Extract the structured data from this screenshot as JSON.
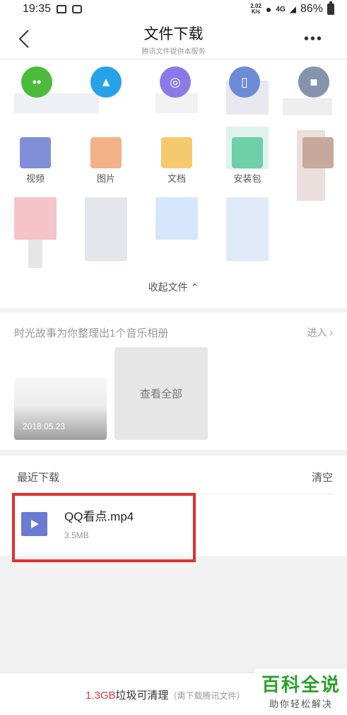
{
  "status_bar": {
    "time": "19:35",
    "speed_value": "2.02",
    "speed_unit": "K/s",
    "network": "4G",
    "battery": "86%"
  },
  "header": {
    "title": "文件下载",
    "subtitle": "腾讯文件提供本服务",
    "more": "•••"
  },
  "file_categories": [
    {
      "label": "",
      "icon": "wechat-icon",
      "color": "#4cbb3b",
      "glyph": "••"
    },
    {
      "label": "",
      "icon": "qq-icon",
      "color": "#26a3e8",
      "glyph": "▲"
    },
    {
      "label": "",
      "icon": "video-icon",
      "color": "#8a7ae8",
      "glyph": "◎"
    },
    {
      "label": "",
      "icon": "phone-icon",
      "color": "#6c8cd8",
      "glyph": "▯"
    },
    {
      "label": "",
      "icon": "lock-icon",
      "color": "#8494ac",
      "glyph": "■"
    },
    {
      "label": "视频",
      "icon": "video-category-icon",
      "color": "#7f8fd8",
      "glyph": ""
    },
    {
      "label": "图片",
      "icon": "image-category-icon",
      "color": "#f3b188",
      "glyph": ""
    },
    {
      "label": "文档",
      "icon": "document-category-icon",
      "color": "#f7c96e",
      "glyph": ""
    },
    {
      "label": "安装包",
      "icon": "package-category-icon",
      "color": "#6fd0a8",
      "glyph": ""
    },
    {
      "label": "",
      "icon": "other-category-icon",
      "color": "#c7a89c",
      "glyph": ""
    }
  ],
  "collapse_label": "收起文件",
  "album": {
    "title": "时光故事为你整理出1个音乐相册",
    "enter_label": "进入",
    "thumb_date": "2018.05.23",
    "view_all_label": "查看全部"
  },
  "recent": {
    "title": "最近下载",
    "clear_label": "清空",
    "files": [
      {
        "name": "QQ看点.mp4",
        "size": "3.5MB"
      }
    ]
  },
  "bottom": {
    "cleanup_size": "1.3GB",
    "cleanup_text": "垃圾可清理",
    "cleanup_note": "（需下载腾讯文件）"
  },
  "watermark": {
    "title": "百科全说",
    "subtitle": "助你轻松解决"
  },
  "colors": {
    "accent_red": "#e53935",
    "highlight_border": "#e03030",
    "watermark_green": "#2aa12a"
  }
}
